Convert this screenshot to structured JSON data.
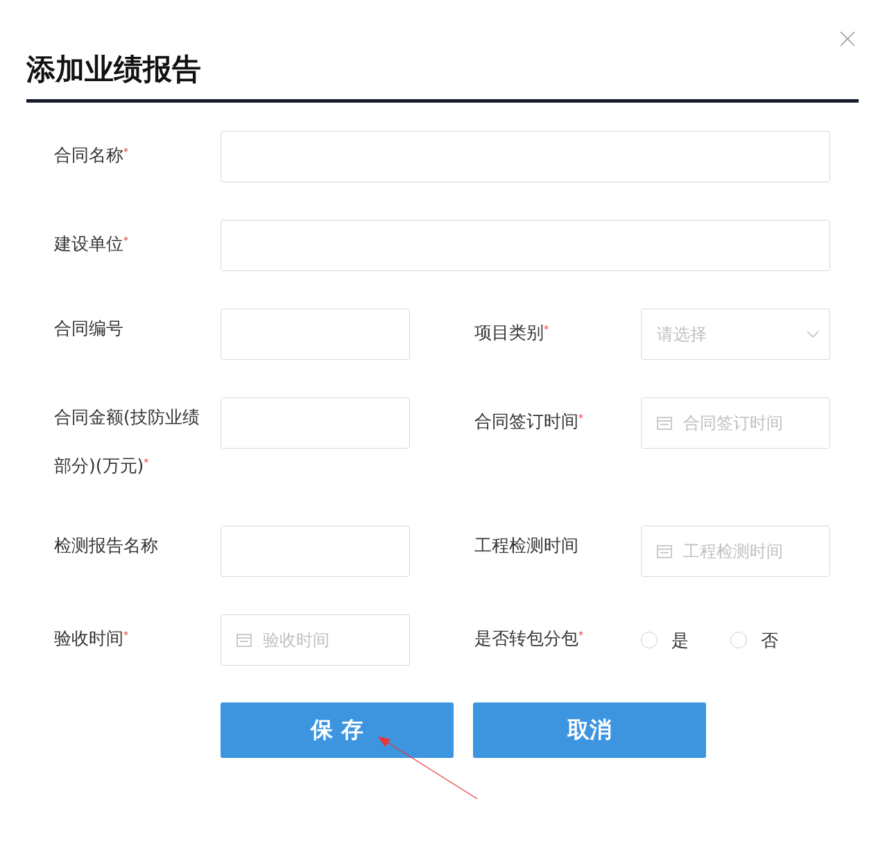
{
  "dialog": {
    "title": "添加业绩报告"
  },
  "fields": [
    {
      "label": "合同名称$^{*}$",
      "kind": "wide"
    },
    {
      "label": "建设单位$^{*}$",
      "kind": "wide"
    },
    {
      "label": "合同编号",
      "kind": "text"
    },
    {
      "label": "项目类别$^{*}$",
      "kind": "select",
      "placeholder": "请选择"
    },
    {
      "label": "合同金额(技防业绩部分)(万元)$^{*}$",
      "kind": "text"
    },
    {
      "label": "合同签订时间$^{*}$",
      "kind": "date",
      "placeholder": "合同签订时间"
    },
    {
      "label": "检测报告名称",
      "kind": "text"
    },
    {
      "label": "工程检测时间",
      "kind": "date",
      "placeholder": "工程检测时间"
    },
    {
      "label": "验收时间$^{*}$",
      "kind": "date",
      "placeholder": "验收时间"
    },
    {
      "label": "是否转包分包$^{*}$",
      "kind": "radio",
      "options": [
        {
          "label": "是",
          "selected": false
        },
        {
          "label": "否",
          "selected": false
        }
      ]
    }
  ],
  "buttons": [
    {
      "label": "保 存"
    },
    {
      "label": "取消"
    }
  ]
}
